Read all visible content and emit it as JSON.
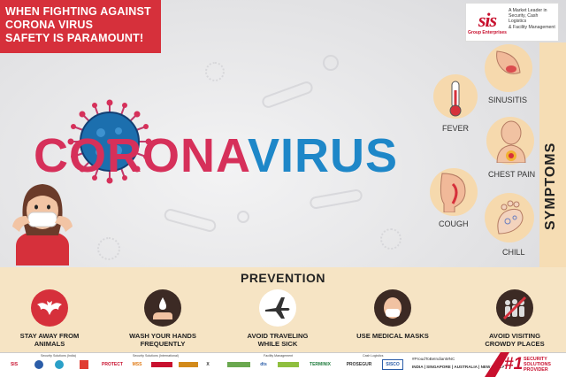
{
  "headline": [
    "WHEN FIGHTING AGAINST",
    "CORONA VIRUS",
    "SAFETY IS PARAMOUNT!"
  ],
  "logo": {
    "mark": "sis",
    "subtitle": "Group Enterprises",
    "tagline": [
      "A Market Leader in",
      "Security, Cash Logistics",
      "& Facility Management"
    ]
  },
  "title": {
    "part1": "CORONA",
    "part2": "VIRUS"
  },
  "symptoms": {
    "heading": "SYMPTOMS",
    "items": [
      "FEVER",
      "SINUSITIS",
      "CHEST PAIN",
      "COUGH",
      "CHILL"
    ]
  },
  "prevention": {
    "heading": "PREVENTION",
    "items": [
      {
        "label": [
          "STAY AWAY FROM",
          "ANIMALS"
        ],
        "icon": "bat-icon"
      },
      {
        "label": [
          "WASH YOUR HANDS",
          "FREQUENTLY"
        ],
        "icon": "hand-wash-icon"
      },
      {
        "label": [
          "AVOID TRAVELING",
          "WHILE SICK"
        ],
        "icon": "airplane-icon"
      },
      {
        "label": [
          "USE MEDICAL MASKS"
        ],
        "icon": "mask-icon"
      },
      {
        "label": [
          "AVOID VISITING",
          "CROWDY PLACES"
        ],
        "icon": "crowd-icon"
      }
    ]
  },
  "footer": {
    "categories": [
      "Security Solutions (India)",
      "Security Solutions (International)",
      "Facility Management",
      "Cash Logistics"
    ],
    "logos": [
      "SIS",
      "",
      "",
      "",
      "PROTECT",
      "MSS",
      "",
      "",
      "X",
      "",
      "dts",
      "",
      "TERMINIX",
      "PROSEGUR",
      "SISCO"
    ],
    "campaign": "#ProudToBeIndianMNC",
    "regions": "INDIA | SINGAPORE | AUSTRALIA | NEW ZEALAND",
    "rank": "#1",
    "rank_text": [
      "SECURITY",
      "SOLUTIONS",
      "PROVIDER"
    ]
  },
  "colors": {
    "red": "#d6303b",
    "pink": "#d6305a",
    "blue": "#1e87c8",
    "peach": "#f6d9ad"
  }
}
